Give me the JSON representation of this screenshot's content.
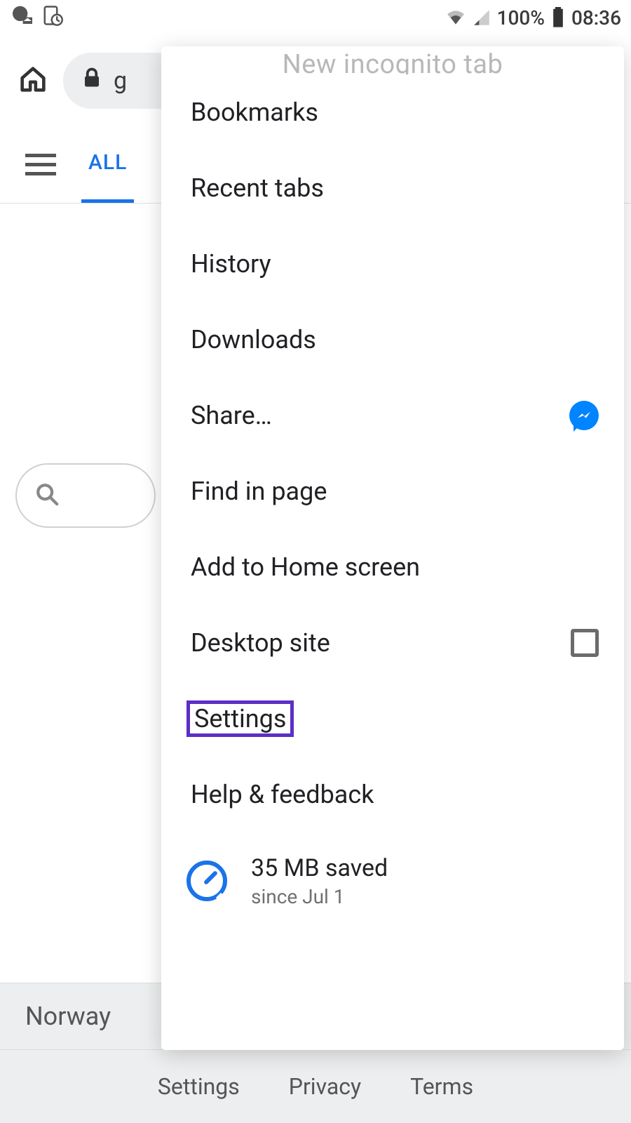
{
  "statusbar": {
    "battery_pct": "100%",
    "time": "08:36"
  },
  "addressbar": {
    "url_fragment": "g"
  },
  "tabs": {
    "all": "ALL"
  },
  "menu": {
    "cutoff": "New incognito tab",
    "items": [
      "Bookmarks",
      "Recent tabs",
      "History",
      "Downloads",
      "Share…",
      "Find in page",
      "Add to Home screen",
      "Desktop site",
      "Settings",
      "Help & feedback"
    ],
    "data_saver": {
      "line1": "35 MB saved",
      "line2": "since Jul 1"
    }
  },
  "footer": {
    "country": "Norway",
    "links": [
      "Settings",
      "Privacy",
      "Terms"
    ]
  }
}
